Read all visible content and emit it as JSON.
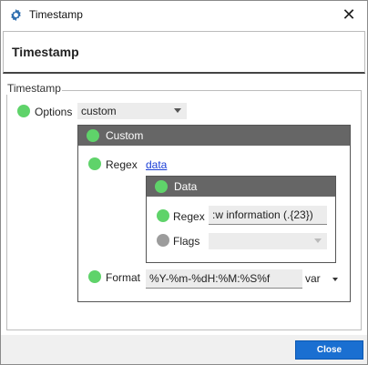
{
  "window": {
    "title": "Timestamp",
    "close_glyph": "✕"
  },
  "header": {
    "title": "Timestamp"
  },
  "group": {
    "label": "Timestamp"
  },
  "options": {
    "label": "Options",
    "selected": "custom"
  },
  "custom_panel": {
    "title": "Custom",
    "regex": {
      "label": "Regex",
      "link": "data"
    },
    "data_panel": {
      "title": "Data",
      "regex": {
        "label": "Regex",
        "value": ":w information (.{23})"
      },
      "flags": {
        "label": "Flags",
        "value": ""
      }
    },
    "format": {
      "label": "Format",
      "value": "%Y-%m-%dH:%M:%S%f",
      "type_select": "var"
    }
  },
  "footer": {
    "close_label": "Close"
  },
  "colors": {
    "accent": "#1a6fd1",
    "status_green": "#5fd36a",
    "status_gray": "#9c9c9c",
    "panel_header": "#666666"
  }
}
